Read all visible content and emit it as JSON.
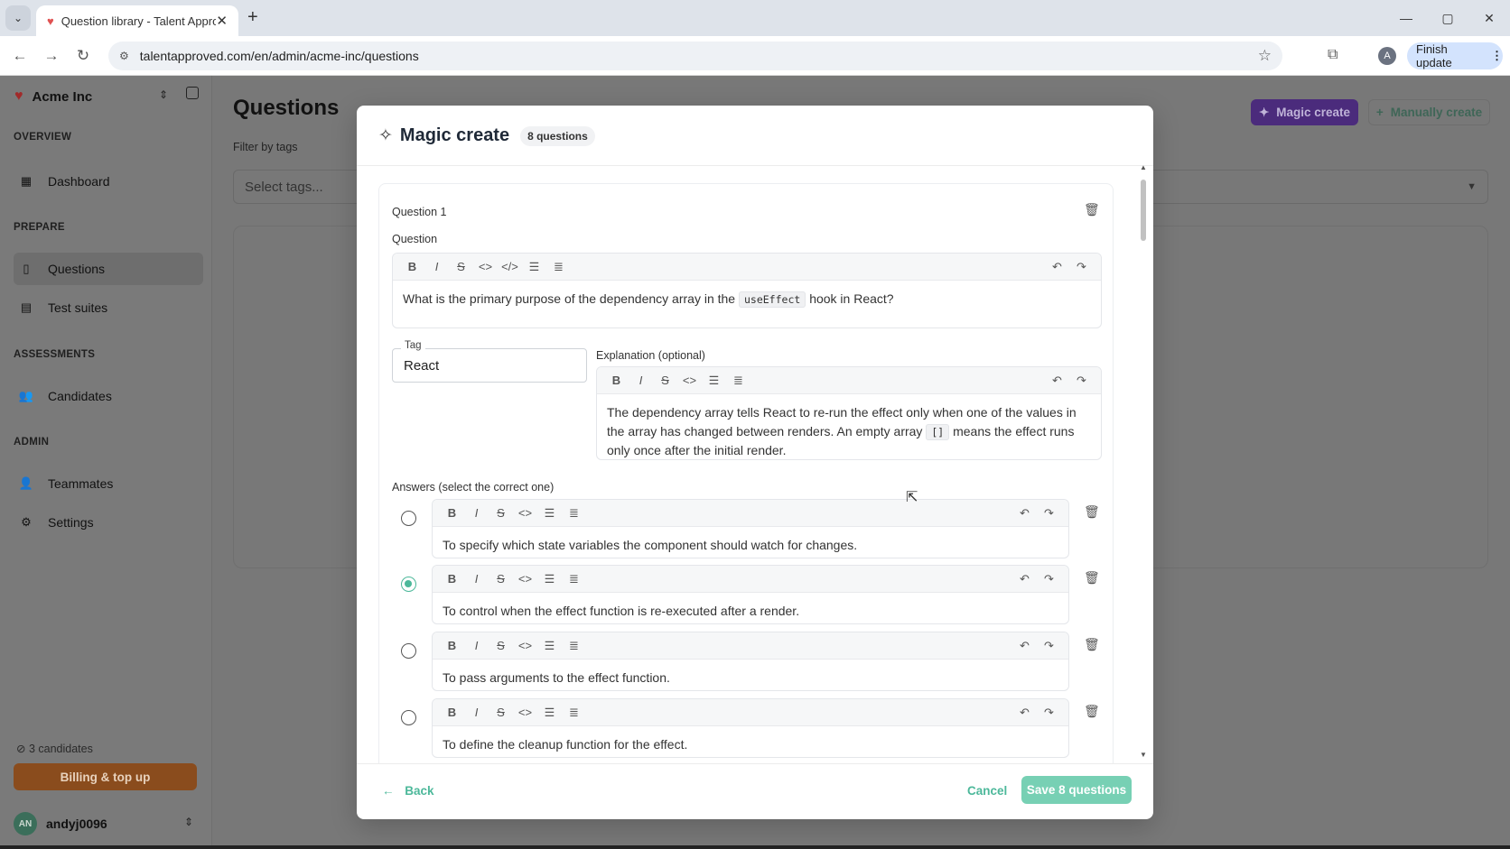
{
  "browser": {
    "tab_title": "Question library - Talent Appro",
    "url": "talentapproved.com/en/admin/acme-inc/questions",
    "profile_initial": "A",
    "finish_update": "Finish update"
  },
  "sidebar": {
    "org_name": "Acme Inc",
    "sections": {
      "overview": "OVERVIEW",
      "prepare": "PREPARE",
      "assessments": "ASSESSMENTS",
      "admin": "ADMIN"
    },
    "items": {
      "dashboard": "Dashboard",
      "questions": "Questions",
      "test_suites": "Test suites",
      "candidates": "Candidates",
      "teammates": "Teammates",
      "settings": "Settings"
    },
    "candidates_count": "3 candidates",
    "billing": "Billing & top up",
    "user_initials": "AN",
    "username": "andyj0096"
  },
  "main": {
    "title": "Questions",
    "filter_label": "Filter by tags",
    "tags_placeholder": "Select tags...",
    "magic_create": "Magic create",
    "manually_create": "Manually create"
  },
  "modal": {
    "title": "Magic create",
    "badge": "8 questions",
    "question_label": "Question 1",
    "question_sub": "Question",
    "question_text_before": "What is the primary purpose of the dependency array in the",
    "question_code": "useEffect",
    "question_text_after": "hook in React?",
    "tag_legend": "Tag",
    "tag_value": "React",
    "explanation_label": "Explanation (optional)",
    "explanation_before": "The dependency array tells React to re-run the effect only when one of the values in the array has changed between renders. An empty array",
    "explanation_code": "[]",
    "explanation_after": "means the effect runs only once after the initial render.",
    "answers_label": "Answers (select the correct one)",
    "answers": [
      {
        "text": "To specify which state variables the component should watch for changes.",
        "correct": false
      },
      {
        "text": "To control when the effect function is re-executed after a render.",
        "correct": true
      },
      {
        "text": "To pass arguments to the effect function.",
        "correct": false
      },
      {
        "text": "To define the cleanup function for the effect.",
        "correct": false
      }
    ],
    "back": "Back",
    "cancel": "Cancel",
    "save": "Save 8 questions"
  },
  "colors": {
    "accent": "#4cb89a",
    "save_button": "#77d0b4",
    "magic_button": "#4b2b7c",
    "billing_button": "#8a4c1d"
  }
}
